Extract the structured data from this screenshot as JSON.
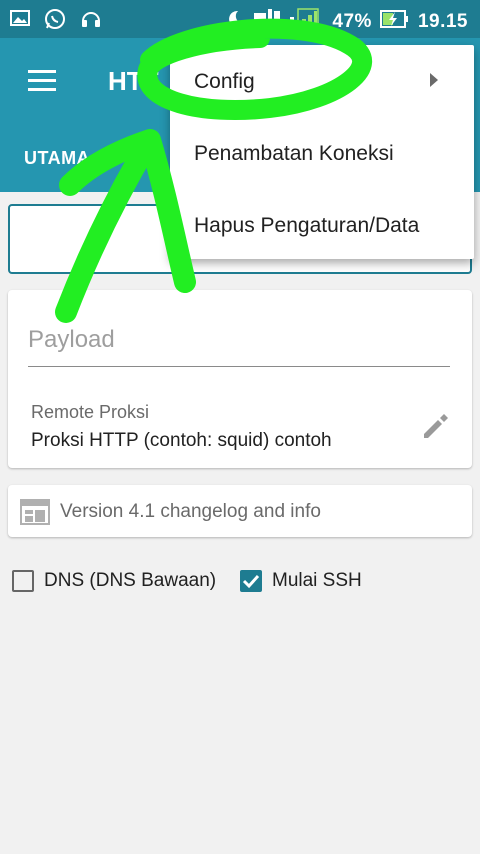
{
  "status_bar": {
    "battery_percent": "47%",
    "time": "19.15",
    "network_badge": "2",
    "icons": [
      "image-icon",
      "whatsapp-icon",
      "headset-icon",
      "moon-icon",
      "signal-icon",
      "battery-charging-icon"
    ]
  },
  "app_bar": {
    "title": "HTT",
    "tab_label": "UTAMA"
  },
  "payload": {
    "placeholder": "Payload"
  },
  "remote_proxy": {
    "label": "Remote Proksi",
    "value": "Proksi HTTP (contoh: squid) contoh"
  },
  "version_info": {
    "text": "Version 4.1 changelog and info"
  },
  "checkboxes": {
    "dns": {
      "label": "DNS (DNS Bawaan)",
      "checked": false
    },
    "ssh": {
      "label": "Mulai SSH",
      "checked": true
    }
  },
  "overflow_menu": {
    "items": [
      {
        "label": "Config",
        "has_submenu": true
      },
      {
        "label": "Penambatan Koneksi"
      },
      {
        "label": "Hapus Pengaturan/Data"
      }
    ]
  },
  "colors": {
    "status_bar": "#1e7c91",
    "app_bar": "#2596b0",
    "accent": "#1e7c91",
    "annotation": "#22ee22"
  }
}
